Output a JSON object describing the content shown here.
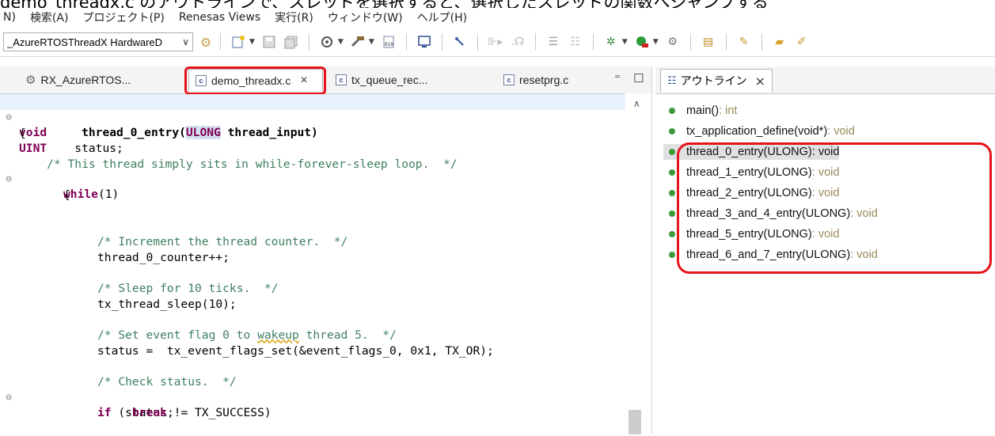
{
  "top_caption": "demo_threadx.c のアウトラインで、スレッドを選択すると、選択したスレッドの関数へジャンプする",
  "menu": [
    "N)",
    "検索(A)",
    "プロジェクト(P)",
    "Renesas Views",
    "実行(R)",
    "ウィンドウ(W)",
    "ヘルプ(H)"
  ],
  "toolbar": {
    "launch_config": "_AzureRTOSThreadX HardwareD",
    "icons": [
      "new-icon",
      "save-icon",
      "save-all-icon",
      "build-config-icon",
      "hammer-icon",
      "binary-icon",
      "console-icon",
      "debug-icon",
      "run-icon",
      "search-icon",
      "debug-bug-icon",
      "run-green-icon",
      "wrench-icon",
      "pen-icon"
    ]
  },
  "editor": {
    "tabs": [
      {
        "label": "RX_AzureRTOS...",
        "icon": "gear-icon"
      },
      {
        "label": "demo_threadx.c",
        "icon": "c-file-icon",
        "active": true
      },
      {
        "label": "tx_queue_rec...",
        "icon": "c-file-icon"
      },
      {
        "label": "resetprg.c",
        "icon": "c-file-icon"
      }
    ],
    "close_glyph": "×",
    "minimize_glyph": "⁼",
    "maximize_glyph": "☐"
  },
  "outline": {
    "tab_label": "アウトライン",
    "items": [
      {
        "name": "main()",
        "type": " : int"
      },
      {
        "name": "tx_application_define(void*)",
        "type": " : void"
      },
      {
        "name": "thread_0_entry(ULONG)",
        "type": " : void",
        "selected": true
      },
      {
        "name": "thread_1_entry(ULONG)",
        "type": " : void"
      },
      {
        "name": "thread_2_entry(ULONG)",
        "type": " : void"
      },
      {
        "name": "thread_3_and_4_entry(ULONG)",
        "type": " : void"
      },
      {
        "name": "thread_5_entry(ULONG)",
        "type": " : void"
      },
      {
        "name": "thread_6_and_7_entry(ULONG)",
        "type": " : void"
      }
    ]
  },
  "code": {
    "l1_kw": "void",
    "l1_fn": "thread_0_entry(",
    "l1_ty": "ULONG",
    "l1_rest": " thread_input)",
    "l2": "{",
    "l3_ty": "UINT",
    "l3_rest": "    status;",
    "l4": "    /* This thread simply sits in while-forever-sleep loop.  */",
    "l5_kw": "while",
    "l5_rest": "(1)",
    "l6": "{",
    "l7": "/* Increment the thread counter.  */",
    "l8": "thread_0_counter++;",
    "l9": "/* Sleep for 10 ticks.  */",
    "l10": "tx_thread_sleep(10);",
    "l11a": "/* Set event flag 0 to ",
    "l11b": "wakeup",
    "l11c": " thread 5.  */",
    "l12": "status =  tx_event_flags_set(&event_flags_0, 0x1, TX_OR);",
    "l13": "/* Check status.  */",
    "l14_kw": "if",
    "l14_rest": " (status != TX_SUCCESS)",
    "l15_kw": "break",
    "l15_rest": ";"
  }
}
